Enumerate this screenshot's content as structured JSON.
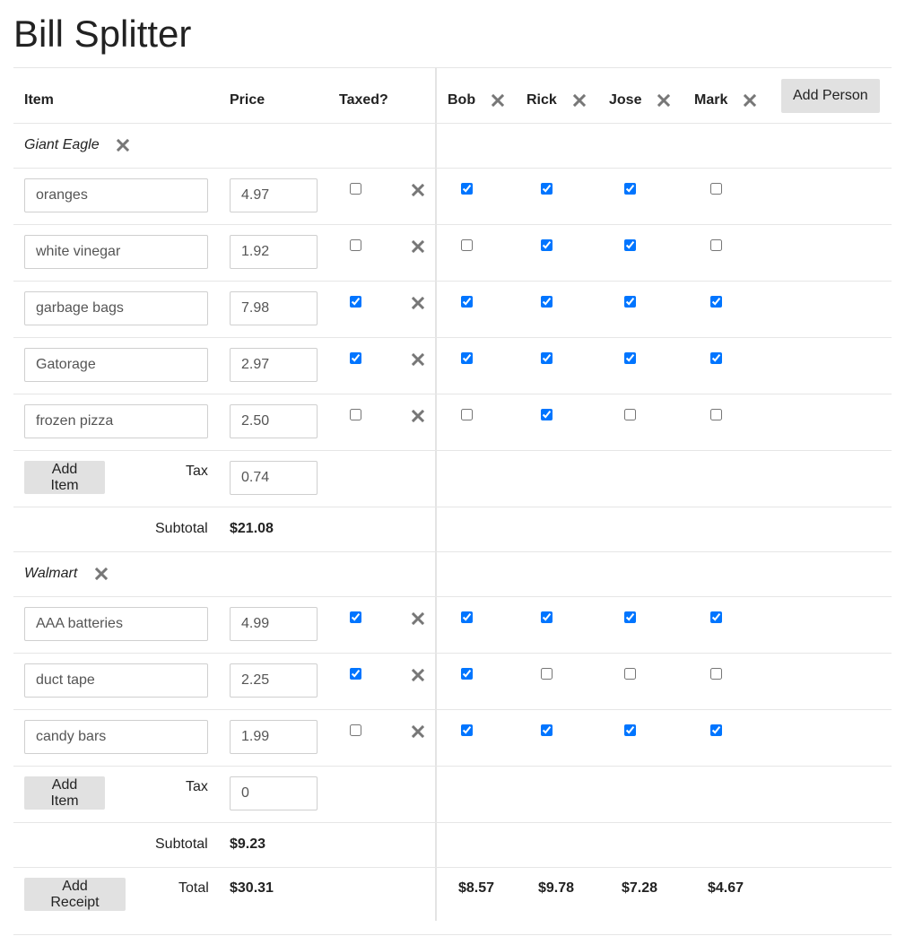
{
  "title": "Bill Splitter",
  "headers": {
    "item": "Item",
    "price": "Price",
    "taxed": "Taxed?"
  },
  "people": [
    "Bob",
    "Rick",
    "Jose",
    "Mark"
  ],
  "add_person_label": "Add Person",
  "add_item_label": "Add Item",
  "add_receipt_label": "Add Receipt",
  "tax_label": "Tax",
  "subtotal_label": "Subtotal",
  "total_label": "Total",
  "receipts": [
    {
      "store": "Giant Eagle",
      "items": [
        {
          "name": "oranges",
          "price": "4.97",
          "taxed": false,
          "shares": [
            true,
            true,
            true,
            false
          ]
        },
        {
          "name": "white vinegar",
          "price": "1.92",
          "taxed": false,
          "shares": [
            false,
            true,
            true,
            false
          ]
        },
        {
          "name": "garbage bags",
          "price": "7.98",
          "taxed": true,
          "shares": [
            true,
            true,
            true,
            true
          ]
        },
        {
          "name": "Gatorage",
          "price": "2.97",
          "taxed": true,
          "shares": [
            true,
            true,
            true,
            true
          ]
        },
        {
          "name": "frozen pizza",
          "price": "2.50",
          "taxed": false,
          "shares": [
            false,
            true,
            false,
            false
          ]
        }
      ],
      "tax": "0.74",
      "subtotal": "$21.08"
    },
    {
      "store": "Walmart",
      "items": [
        {
          "name": "AAA batteries",
          "price": "4.99",
          "taxed": true,
          "shares": [
            true,
            true,
            true,
            true
          ]
        },
        {
          "name": "duct tape",
          "price": "2.25",
          "taxed": true,
          "shares": [
            true,
            false,
            false,
            false
          ]
        },
        {
          "name": "candy bars",
          "price": "1.99",
          "taxed": false,
          "shares": [
            true,
            true,
            true,
            true
          ]
        }
      ],
      "tax": "0",
      "subtotal": "$9.23"
    }
  ],
  "total": "$30.31",
  "person_totals": [
    "$8.57",
    "$9.78",
    "$7.28",
    "$4.67"
  ],
  "icons": {
    "remove": "close-icon"
  },
  "colors": {
    "button_bg": "#e1e1e1",
    "remove_icon": "#777777",
    "divider": "#e6e6e6"
  }
}
